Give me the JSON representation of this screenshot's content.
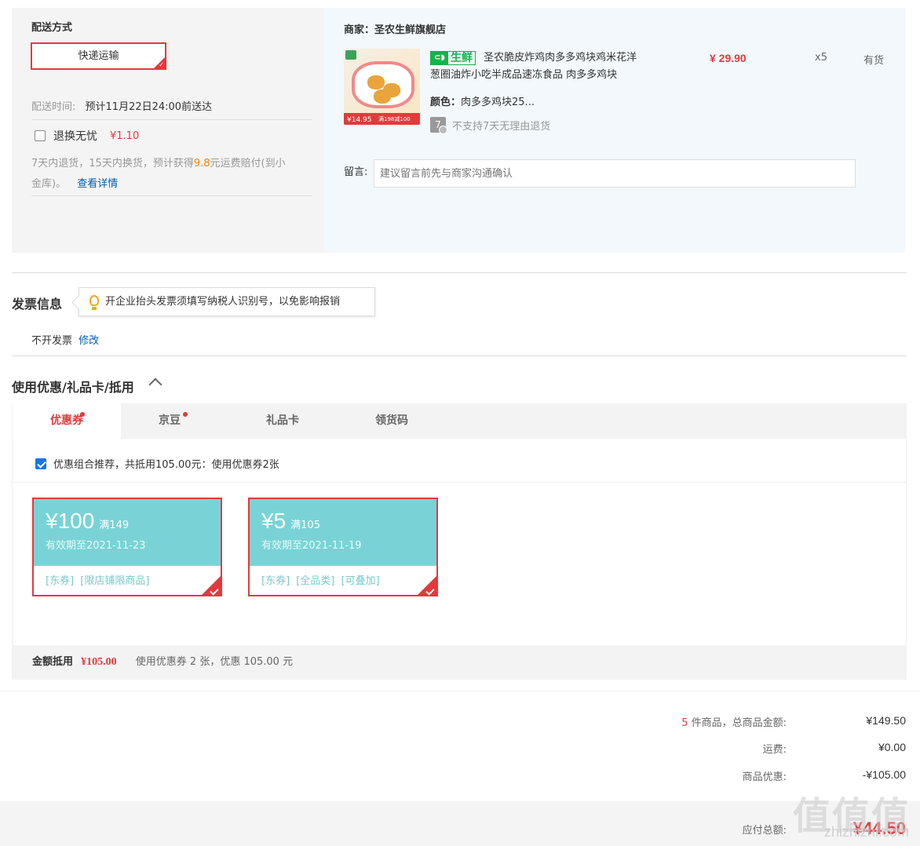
{
  "shipping": {
    "title": "配送方式",
    "method": "快递运输",
    "time_label": "配送时间:",
    "time_value": "预计11月22日24:00前送达",
    "return_label": "退换无忧",
    "return_price": "¥1.10",
    "return_desc_1": "7天内退货，15天内换货，预计获得",
    "return_desc_amount": "9.8",
    "return_desc_2": "元运费赔付(到小",
    "return_desc_3": "金库)。",
    "details_link": "查看详情"
  },
  "shop": {
    "label": "商家：圣农生鲜旗舰店",
    "badge_icon": "fish-icon",
    "badge_text": "生鲜",
    "product_title_line1": "圣农脆皮炸鸡肉多多鸡块鸡米花洋",
    "product_title_line2": "葱圈油炸小吃半成品速冻食品 肉多多鸡块",
    "price": "¥ 29.90",
    "qty": "x5",
    "stock": "有货",
    "color_label": "颜色：",
    "color_value": "肉多多鸡块25...",
    "seven_day_icon": "7",
    "no_return_text": "不支持7天无理由退货",
    "image_price": "¥14.95",
    "image_promo": "满198减100",
    "message_label": "留言:",
    "message_placeholder": "建议留言前先与商家沟通确认"
  },
  "invoice": {
    "title": "发票信息",
    "tip": "开企业抬头发票须填写纳税人识别号，以免影响报销",
    "status": "不开发票",
    "edit": "修改"
  },
  "coupons": {
    "title": "使用优惠/礼品卡/抵用",
    "tabs": [
      {
        "label": "优惠券"
      },
      {
        "label": "京豆"
      },
      {
        "label": "礼品卡"
      },
      {
        "label": "领货码"
      }
    ],
    "combo_text": "优惠组合推荐，共抵用105.00元：使用优惠券2张",
    "items": [
      {
        "amount": "¥100",
        "condition": "满149",
        "expiry": "有效期至2021-11-23",
        "tag1": "[东券]",
        "tag2": "[限店铺限商品]",
        "tag3": ""
      },
      {
        "amount": "¥5",
        "condition": "满105",
        "expiry": "有效期至2021-11-19",
        "tag1": "[东券]",
        "tag2": "[全品类]",
        "tag3": "[可叠加]"
      }
    ],
    "summary_label": "金额抵用",
    "summary_amount": "¥105.00",
    "summary_desc": "使用优惠券 2 张，优惠 105.00 元"
  },
  "totals": {
    "count": "5",
    "goods_label": "件商品，总商品金额:",
    "goods_value": "¥149.50",
    "freight_label": "运费:",
    "freight_value": "¥0.00",
    "discount_label": "商品优惠:",
    "discount_value": "-¥105.00",
    "payable_label": "应付总额:",
    "payable_value": "¥44.50"
  },
  "watermark": {
    "main": "值值值",
    "sub": "zhizhizhi.com"
  },
  "colors": {
    "accent": "#e4393c",
    "coupon": "#79d3d6",
    "fresh": "#16b349",
    "link": "#005ea7"
  }
}
